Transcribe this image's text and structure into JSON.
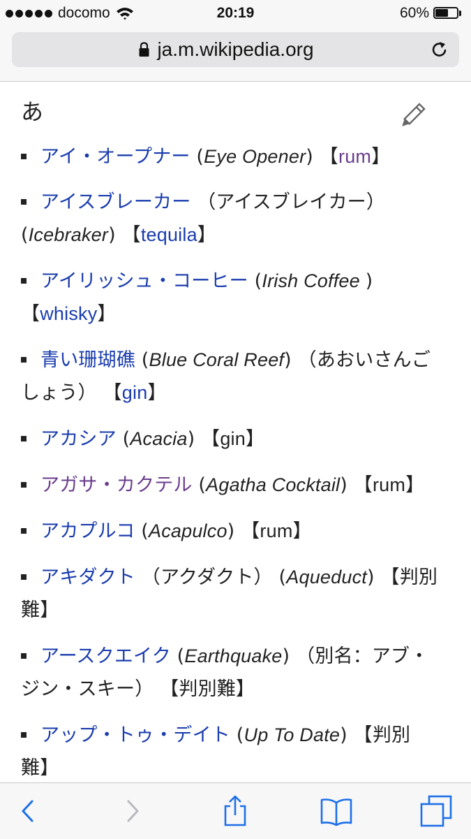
{
  "status_bar": {
    "carrier": "docomo",
    "time": "20:19",
    "battery": "60%",
    "battery_level": 0.6
  },
  "address_bar": {
    "url": "ja.m.wikipedia.org"
  },
  "section": {
    "heading": "あ"
  },
  "items": [
    {
      "link": "アイ・オープナー",
      "visited": false,
      "en_open": " (",
      "en": "Eye Opener",
      "en_close": ") ",
      "extra": "",
      "base_open": "【",
      "base": "rum",
      "base_linked": true,
      "base_visited": true,
      "base_close": "】"
    },
    {
      "link": "アイスブレーカー",
      "visited": false,
      "extra_before": " （アイスブレイカー） ",
      "en_open": "(",
      "en": "Icebraker",
      "en_close": ") ",
      "extra": "",
      "base_open": "【",
      "base": "tequila",
      "base_linked": true,
      "base_visited": false,
      "base_close": "】"
    },
    {
      "link": "アイリッシュ・コーヒー",
      "visited": false,
      "en_open": " (",
      "en": "Irish Coffee ",
      "en_close": ") ",
      "extra": "",
      "base_open": "【",
      "base": "whisky",
      "base_linked": true,
      "base_visited": false,
      "base_close": "】"
    },
    {
      "link": "青い珊瑚礁",
      "visited": false,
      "en_open": " (",
      "en": "Blue Coral Reef",
      "en_close": ") ",
      "extra": "（あおいさんごしょう） ",
      "base_open": "【",
      "base": "gin",
      "base_linked": true,
      "base_visited": false,
      "base_close": "】"
    },
    {
      "link": "アカシア",
      "visited": false,
      "en_open": " (",
      "en": "Acacia",
      "en_close": ") ",
      "extra": "",
      "base_open": "【",
      "base": "gin",
      "base_linked": false,
      "base_visited": false,
      "base_close": "】"
    },
    {
      "link": "アガサ・カクテル",
      "visited": true,
      "en_open": " (",
      "en": "Agatha Cocktail",
      "en_close": ") ",
      "extra": "",
      "base_open": "【",
      "base": "rum",
      "base_linked": false,
      "base_visited": false,
      "base_close": "】"
    },
    {
      "link": "アカプルコ",
      "visited": false,
      "en_open": " (",
      "en": "Acapulco",
      "en_close": ") ",
      "extra": "",
      "base_open": "【",
      "base": "rum",
      "base_linked": false,
      "base_visited": false,
      "base_close": "】"
    },
    {
      "link": "アキダクト",
      "visited": false,
      "extra_before": " （アクダクト） ",
      "en_open": "(",
      "en": "Aqueduct",
      "en_close": ") ",
      "extra": "",
      "base_open": "【",
      "base": "判別難",
      "base_linked": false,
      "base_visited": false,
      "base_close": "】"
    },
    {
      "link": "アースクエイク",
      "visited": false,
      "en_open": " (",
      "en": "Earthquake",
      "en_close": ") ",
      "extra": "（別名：アブ・ジン・スキー） ",
      "base_open": "【",
      "base": "判別難",
      "base_linked": false,
      "base_visited": false,
      "base_close": "】"
    },
    {
      "link": "アップ・トゥ・デイト",
      "visited": false,
      "en_open": " (",
      "en": "Up To Date",
      "en_close": ") ",
      "extra": "",
      "base_open": "【",
      "base": "判別難",
      "base_linked": false,
      "base_visited": false,
      "base_close": "】"
    }
  ]
}
